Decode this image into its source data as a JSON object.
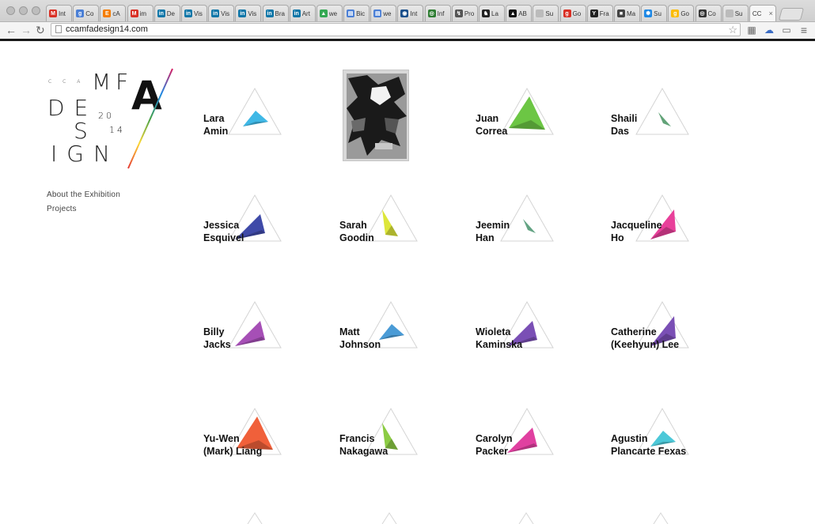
{
  "browser": {
    "url": "ccamfadesign14.com",
    "tabs": [
      {
        "label": "Int",
        "color": "#d93025",
        "glyph": "M"
      },
      {
        "label": "Co",
        "color": "#4a7fd6",
        "glyph": "g"
      },
      {
        "label": "cA",
        "color": "#f57c00",
        "glyph": "E"
      },
      {
        "label": "im",
        "color": "#d93025",
        "glyph": "M"
      },
      {
        "label": "De",
        "color": "#0e76a8",
        "glyph": "in"
      },
      {
        "label": "Vis",
        "color": "#0e76a8",
        "glyph": "in"
      },
      {
        "label": "Vis",
        "color": "#0e76a8",
        "glyph": "in"
      },
      {
        "label": "Vis",
        "color": "#0e76a8",
        "glyph": "in"
      },
      {
        "label": "Bra",
        "color": "#0e76a8",
        "glyph": "in"
      },
      {
        "label": "Art",
        "color": "#0e76a8",
        "glyph": "in"
      },
      {
        "label": "we",
        "color": "#34a853",
        "glyph": "▲"
      },
      {
        "label": "Bic",
        "color": "#4a7fd6",
        "glyph": "▤"
      },
      {
        "label": "we",
        "color": "#4a7fd6",
        "glyph": "▤"
      },
      {
        "label": "Int",
        "color": "#1a4f8b",
        "glyph": "◉"
      },
      {
        "label": "Inf",
        "color": "#2e7d32",
        "glyph": "◎"
      },
      {
        "label": "Pro",
        "color": "#555555",
        "glyph": "↯"
      },
      {
        "label": "La",
        "color": "#222222",
        "glyph": "♞"
      },
      {
        "label": "AB",
        "color": "#111111",
        "glyph": "▲"
      },
      {
        "label": "Su",
        "color": "#bbbbbb",
        "glyph": ""
      },
      {
        "label": "Go",
        "color": "#d93025",
        "glyph": "g"
      },
      {
        "label": "Fra",
        "color": "#222222",
        "glyph": "Y"
      },
      {
        "label": "Ma",
        "color": "#444444",
        "glyph": "■"
      },
      {
        "label": "Su",
        "color": "#1e88e5",
        "glyph": "✽"
      },
      {
        "label": "Go",
        "color": "#fbbc05",
        "glyph": "g"
      },
      {
        "label": "Co",
        "color": "#333333",
        "glyph": "◎"
      },
      {
        "label": "Su",
        "color": "#bbbbbb",
        "glyph": ""
      },
      {
        "label": "CC",
        "color": "#ffffff",
        "glyph": "",
        "active": true
      }
    ]
  },
  "logo": {
    "cca": "C C  A",
    "mf": "MF",
    "a": "A",
    "de": "DE",
    "s": "S",
    "ign": "IGN",
    "year_a": "20",
    "year_b": "14"
  },
  "menu": {
    "about": "About the Exhibition",
    "projects": "Projects"
  },
  "students": [
    {
      "first": "Lara",
      "last": "Amin",
      "color": "#3fb8e6",
      "shape": "flat"
    },
    {
      "first": "",
      "last": "",
      "color": "#555555",
      "shape": "image"
    },
    {
      "first": "Juan",
      "last": "Correa",
      "color": "#6cc644",
      "shape": "big"
    },
    {
      "first": "Shaili",
      "last": "Das",
      "color": "#7ed19a",
      "shape": "sliver"
    },
    {
      "first": "Jessica",
      "last": "Esquivel",
      "color": "#3f4aa8",
      "shape": "wing"
    },
    {
      "first": "Sarah",
      "last": "Goodin",
      "color": "#dde63a",
      "shape": "tall"
    },
    {
      "first": "Jeemin",
      "last": "Han",
      "color": "#7fd1a8",
      "shape": "sliver"
    },
    {
      "first": "Jacqueline",
      "last": "Ho",
      "color": "#e8409a",
      "shape": "kite"
    },
    {
      "first": "Billy",
      "last": "Jacks",
      "color": "#a64fb6",
      "shape": "wing"
    },
    {
      "first": "Matt",
      "last": "Johnson",
      "color": "#4a9bd6",
      "shape": "flat"
    },
    {
      "first": "Wioleta",
      "last": "Kaminska",
      "color": "#7a4fb5",
      "shape": "wing"
    },
    {
      "first": "Catherine",
      "last": "(Keehyun) Lee",
      "color": "#7a4fb5",
      "shape": "kite"
    },
    {
      "first": "Yu-Wen",
      "last": "(Mark) Liang",
      "color": "#f0603a",
      "shape": "big"
    },
    {
      "first": "Francis",
      "last": "Nakagawa",
      "color": "#8ccc44",
      "shape": "tall"
    },
    {
      "first": "Carolyn",
      "last": "Packer",
      "color": "#e040a0",
      "shape": "wing"
    },
    {
      "first": "Agustin",
      "last": "Plancarte Fexas",
      "color": "#4cc8d8",
      "shape": "flat"
    }
  ]
}
